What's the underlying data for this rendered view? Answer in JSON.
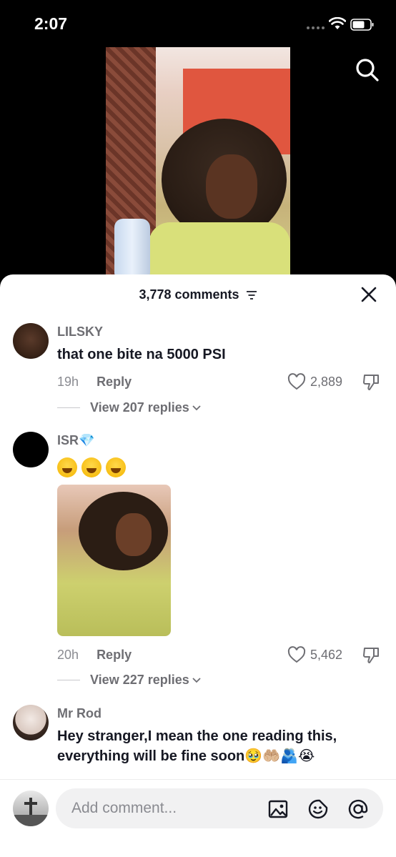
{
  "status_bar": {
    "time": "2:07"
  },
  "comments_header": {
    "count_label": "3,778 comments"
  },
  "comments": [
    {
      "username": "LILSKY",
      "text": "that one bite na 5000 PSI",
      "time": "19h",
      "reply_label": "Reply",
      "likes": "2,889",
      "view_replies": "View 207 replies"
    },
    {
      "username": "ISR💎",
      "text": "😂😂😂",
      "time": "20h",
      "reply_label": "Reply",
      "likes": "5,462",
      "view_replies": "View 227 replies"
    },
    {
      "username": "Mr Rod",
      "text_line1": "Hey stranger,I mean the one reading this,",
      "text_line2": "everything will be fine soon🥹🤲🏼🫂😭"
    }
  ],
  "input": {
    "placeholder": "Add comment..."
  },
  "icons": {
    "search": "search-icon",
    "filter": "filter-icon",
    "close": "close-icon",
    "like": "heart-icon",
    "dislike": "thumbs-down-icon",
    "image": "image-icon",
    "sticker": "sticker-icon",
    "mention": "at-sign-icon"
  }
}
